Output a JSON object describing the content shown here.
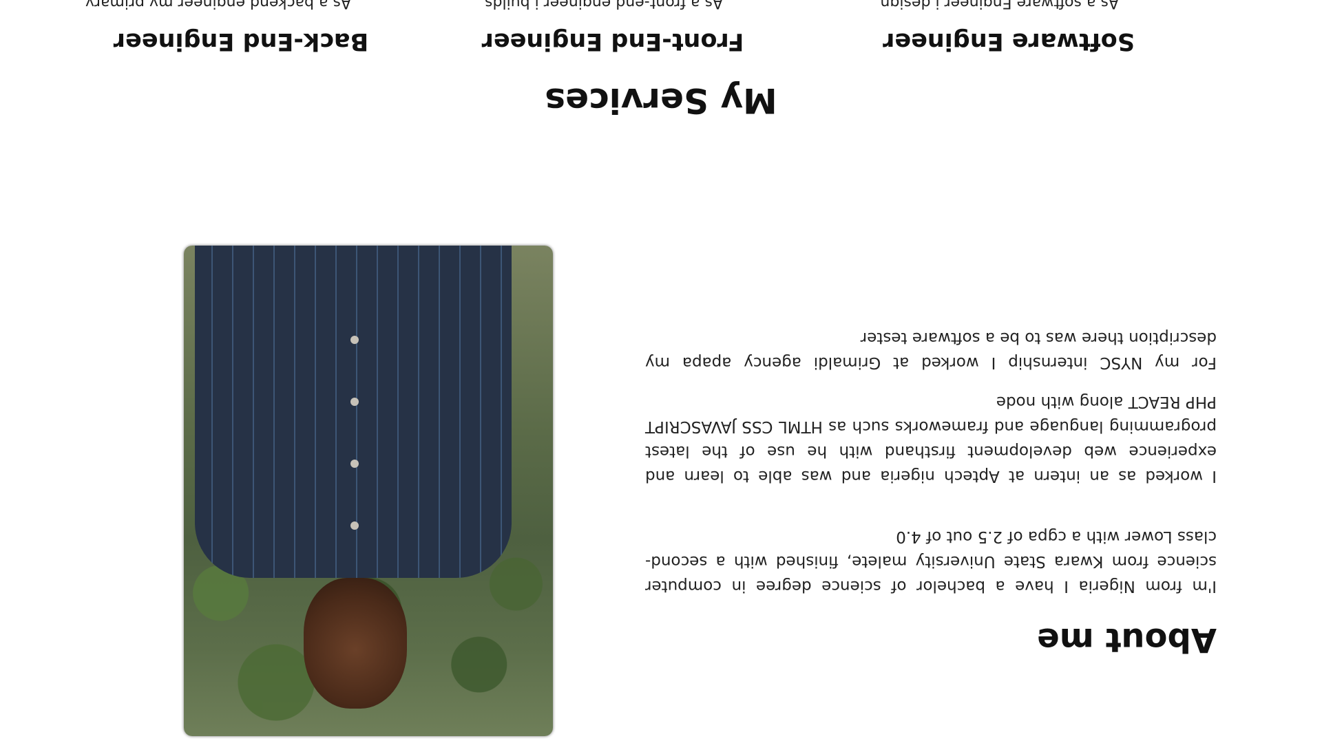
{
  "about": {
    "title": "About me",
    "paragraphs": [
      "I'm from Nigeria I have a bachelor of science degree in computer science from Kwara State University malete, finished with a second-class Lower with a cgpa of 2.5 out of 4.0",
      "I worked as an intern at Aptech nigeria and was able to learn and experience web development firsthand with he use of the latest programming language and frameworks such as HTML CSS JAVASCRIPT PHP REACT along with node",
      "For my NYSC internship I worked at Grimaldi agency apapa my description there was to be a software tester"
    ],
    "photo_alt": "Portrait photo"
  },
  "services": {
    "title": "My Services",
    "items": [
      {
        "title": "Software Engineer",
        "description": "As a software Engineer i design, analyze and"
      },
      {
        "title": "Front-End Engineer",
        "description": "As a front-end engineer i builds websites"
      },
      {
        "title": "Back-End Engineer",
        "description": "As a backend engineer my primary"
      }
    ]
  }
}
